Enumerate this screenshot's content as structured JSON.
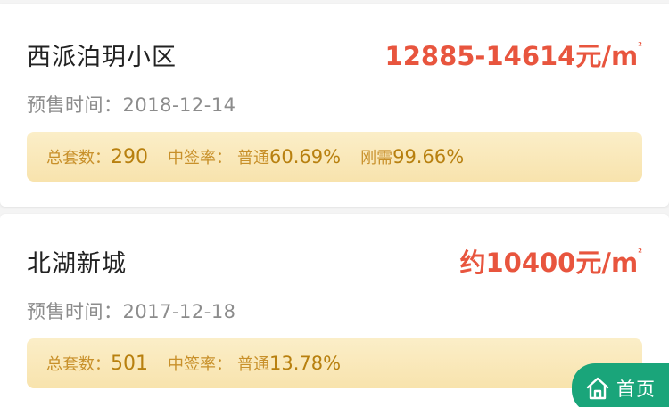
{
  "listings": [
    {
      "name": "西派泊玥小区",
      "price": "12885-14614元/m",
      "price_sup": "²",
      "presale_label": "预售时间：",
      "presale_date": "2018-12-14",
      "total_label": "总套数：",
      "total_value": "290",
      "rate_label": "中签率：",
      "normal_label": "普通",
      "normal_rate": "60.69%",
      "rigid_label": "刚需",
      "rigid_rate": "99.66%"
    },
    {
      "name": "北湖新城",
      "price": "约10400元/m",
      "price_sup": "²",
      "presale_label": "预售时间：",
      "presale_date": "2017-12-18",
      "total_label": "总套数：",
      "total_value": "501",
      "rate_label": "中签率：",
      "normal_label": "普通",
      "normal_rate": "13.78%"
    }
  ],
  "home_button": {
    "label": "首页",
    "icon": "home-icon"
  },
  "colors": {
    "price": "#e8553e",
    "stats_text": "#c8902a",
    "stats_bg": "#f8e3ad",
    "home_button_bg": "#1aa57a"
  }
}
